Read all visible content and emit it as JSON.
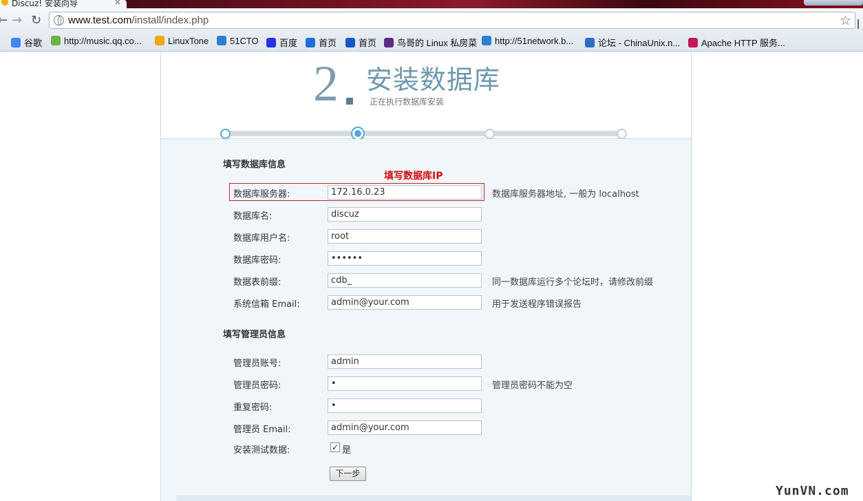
{
  "browser": {
    "tab_title": "Discuz! 安装向导",
    "url_host": "www.test.com",
    "url_path": "/install/index.php"
  },
  "bookmarks": [
    {
      "label": "谷歌",
      "icon": "google-icon",
      "color": "#4285f4"
    },
    {
      "label": "http://music.qq.co...",
      "icon": "qq-music-icon",
      "color": "#6db33f"
    },
    {
      "label": "LinuxTone",
      "icon": "linuxtone-icon",
      "color": "#f0a800"
    },
    {
      "label": "51CTO",
      "icon": "51cto-icon",
      "color": "#2a7fd0"
    },
    {
      "label": "百度",
      "icon": "baidu-paw-icon",
      "color": "#2932e1"
    },
    {
      "label": "首页",
      "icon": "play-icon",
      "color": "#1e6fd6"
    },
    {
      "label": "首页",
      "icon": "opera-o-icon",
      "color": "#1456c8"
    },
    {
      "label": "鸟哥的 Linux 私房菜",
      "icon": "bird-icon",
      "color": "#5a2d82"
    },
    {
      "label": "http://51network.b...",
      "icon": "51network-icon",
      "color": "#2a7fd0"
    },
    {
      "label": "论坛 - ChinaUnix.n...",
      "icon": "chinaunix-icon",
      "color": "#2e6fc0"
    },
    {
      "label": "Apache HTTP 服务...",
      "icon": "apache-feather-icon",
      "color": "#c2185b"
    }
  ],
  "header": {
    "step_number": "2",
    "title": "安装数据库",
    "subtitle": "正在执行数据库安装",
    "progress_current_step": 2,
    "progress_total_steps": 4
  },
  "db_section": {
    "heading": "填写数据库信息",
    "annotation": "填写数据库IP",
    "fields": [
      {
        "label": "数据库服务器:",
        "value": "172.16.0.23",
        "hint": "数据库服务器地址, 一般为 localhost"
      },
      {
        "label": "数据库名:",
        "value": "discuz",
        "hint": ""
      },
      {
        "label": "数据库用户名:",
        "value": "root",
        "hint": ""
      },
      {
        "label": "数据库密码:",
        "value": "••••••",
        "hint": ""
      },
      {
        "label": "数据表前缀:",
        "value": "cdb_",
        "hint": "同一数据库运行多个论坛时，请修改前缀"
      },
      {
        "label": "系统信箱 Email:",
        "value": "admin@your.com",
        "hint": "用于发送程序错误报告"
      }
    ]
  },
  "admin_section": {
    "heading": "填写管理员信息",
    "fields": [
      {
        "label": "管理员账号:",
        "value": "admin",
        "hint": ""
      },
      {
        "label": "管理员密码:",
        "value": "•",
        "hint": "管理员密码不能为空"
      },
      {
        "label": "重复密码:",
        "value": "•",
        "hint": ""
      },
      {
        "label": "管理员 Email:",
        "value": "admin@your.com",
        "hint": ""
      }
    ],
    "test_data_label": "安装测试数据:",
    "test_data_checkbox": "是",
    "test_data_checked": true
  },
  "next_button": "下一步",
  "watermark": "YunVN.com",
  "colors": {
    "accent_blue": "#4ea7df",
    "title_blue": "#6f98ad",
    "highlight_red": "#c0272d",
    "form_bg": "#f0f6fa"
  }
}
